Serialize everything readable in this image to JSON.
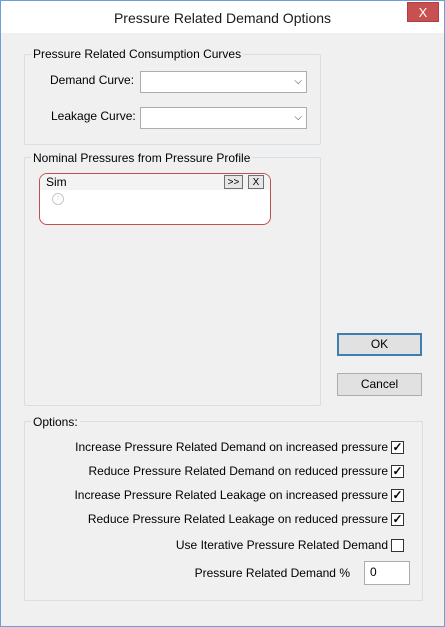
{
  "window": {
    "title": "Pressure Related Demand Options",
    "close_glyph": "X"
  },
  "consumption_group": {
    "label": "Pressure Related Consumption Curves",
    "demand_curve_label": "Demand Curve:",
    "demand_curve_value": "",
    "leakage_curve_label": "Leakage Curve:",
    "leakage_curve_value": ""
  },
  "profile_group": {
    "label": "Nominal Pressures from Pressure Profile",
    "profile_name": "Sim",
    "add_button": ">>",
    "remove_button": "X"
  },
  "buttons": {
    "ok": "OK",
    "cancel": "Cancel"
  },
  "options": {
    "label": "Options:",
    "items": [
      {
        "label": "Increase Pressure Related Demand on increased pressure",
        "checked": true,
        "glyph": "✓"
      },
      {
        "label": "Reduce Pressure Related Demand on reduced pressure",
        "checked": true,
        "glyph": "✓"
      },
      {
        "label": "Increase Pressure Related Leakage on increased pressure",
        "checked": true,
        "glyph": "✓"
      },
      {
        "label": "Reduce Pressure Related Leakage on reduced pressure",
        "checked": true,
        "glyph": "✓"
      },
      {
        "label": "Use Iterative Pressure Related Demand",
        "checked": false,
        "glyph": ""
      }
    ],
    "percent_label": "Pressure Related Demand %",
    "percent_value": "0"
  },
  "colors": {
    "accent_border": "#c0504d",
    "close_button": "#c75050",
    "default_button_border": "#3c7fb1"
  }
}
